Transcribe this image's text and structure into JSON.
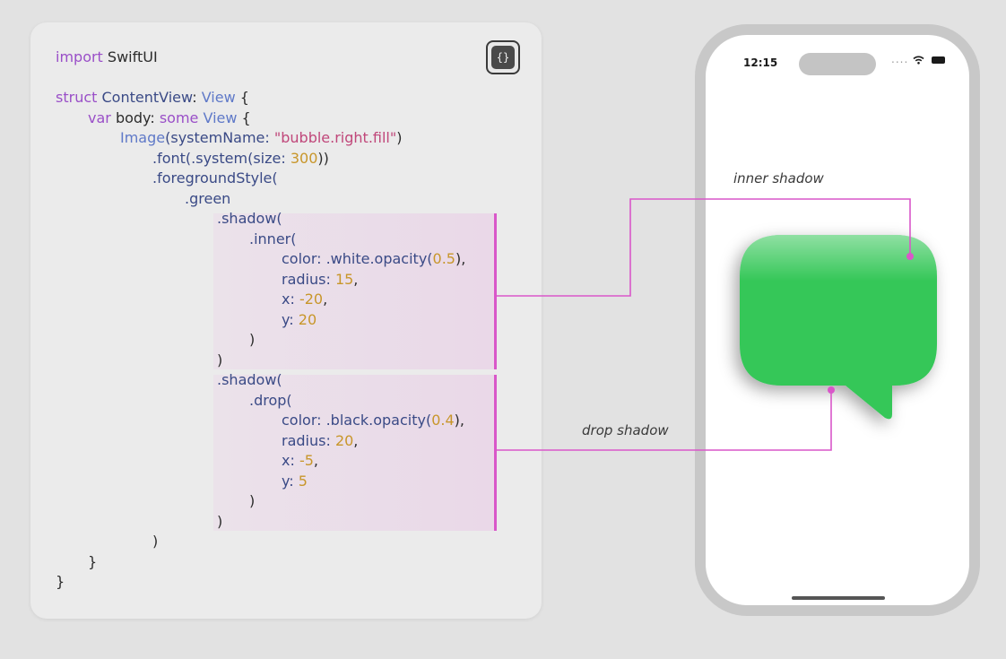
{
  "code_button": {
    "glyph": "{}"
  },
  "code_lines": [
    {
      "indent": 0,
      "tokens": [
        {
          "t": "import",
          "c": "kw"
        },
        {
          "t": " SwiftUI",
          "c": "plain"
        }
      ]
    },
    {
      "indent": 0,
      "tokens": []
    },
    {
      "indent": 0,
      "tokens": [
        {
          "t": "struct",
          "c": "kw"
        },
        {
          "t": " ContentView",
          "c": "id"
        },
        {
          "t": ": ",
          "c": "plain"
        },
        {
          "t": "View",
          "c": "type"
        },
        {
          "t": " {",
          "c": "plain"
        }
      ]
    },
    {
      "indent": 1,
      "tokens": [
        {
          "t": "var",
          "c": "kw"
        },
        {
          "t": " body: ",
          "c": "plain"
        },
        {
          "t": "some",
          "c": "kw"
        },
        {
          "t": " View",
          "c": "type"
        },
        {
          "t": " {",
          "c": "plain"
        }
      ]
    },
    {
      "indent": 2,
      "tokens": [
        {
          "t": "Image",
          "c": "type"
        },
        {
          "t": "(systemName: ",
          "c": "id"
        },
        {
          "t": "\"bubble.right.fill\"",
          "c": "str"
        },
        {
          "t": ")",
          "c": "plain"
        }
      ]
    },
    {
      "indent": 3,
      "tokens": [
        {
          "t": ".font(.system(size: ",
          "c": "id"
        },
        {
          "t": "300",
          "c": "num"
        },
        {
          "t": "))",
          "c": "plain"
        }
      ]
    },
    {
      "indent": 3,
      "tokens": [
        {
          "t": ".foregroundStyle(",
          "c": "id"
        }
      ]
    },
    {
      "indent": 4,
      "tokens": [
        {
          "t": ".green",
          "c": "id"
        }
      ]
    },
    {
      "indent": 5,
      "tokens": [
        {
          "t": ".shadow(",
          "c": "id"
        }
      ]
    },
    {
      "indent": 6,
      "tokens": [
        {
          "t": ".inner(",
          "c": "id"
        }
      ]
    },
    {
      "indent": 7,
      "tokens": [
        {
          "t": "color: .white.opacity(",
          "c": "id"
        },
        {
          "t": "0.5",
          "c": "num"
        },
        {
          "t": "),",
          "c": "plain"
        }
      ]
    },
    {
      "indent": 7,
      "tokens": [
        {
          "t": "radius: ",
          "c": "id"
        },
        {
          "t": "15",
          "c": "num"
        },
        {
          "t": ",",
          "c": "plain"
        }
      ]
    },
    {
      "indent": 7,
      "tokens": [
        {
          "t": "x: ",
          "c": "id"
        },
        {
          "t": "-20",
          "c": "num"
        },
        {
          "t": ",",
          "c": "plain"
        }
      ]
    },
    {
      "indent": 7,
      "tokens": [
        {
          "t": "y: ",
          "c": "id"
        },
        {
          "t": "20",
          "c": "num"
        }
      ]
    },
    {
      "indent": 6,
      "tokens": [
        {
          "t": ")",
          "c": "plain"
        }
      ]
    },
    {
      "indent": 5,
      "tokens": [
        {
          "t": ")",
          "c": "plain"
        }
      ]
    },
    {
      "indent": 5,
      "tokens": [
        {
          "t": ".shadow(",
          "c": "id"
        }
      ]
    },
    {
      "indent": 6,
      "tokens": [
        {
          "t": ".drop(",
          "c": "id"
        }
      ]
    },
    {
      "indent": 7,
      "tokens": [
        {
          "t": "color: .black.opacity(",
          "c": "id"
        },
        {
          "t": "0.4",
          "c": "num"
        },
        {
          "t": "),",
          "c": "plain"
        }
      ]
    },
    {
      "indent": 7,
      "tokens": [
        {
          "t": "radius: ",
          "c": "id"
        },
        {
          "t": "20",
          "c": "num"
        },
        {
          "t": ",",
          "c": "plain"
        }
      ]
    },
    {
      "indent": 7,
      "tokens": [
        {
          "t": "x: ",
          "c": "id"
        },
        {
          "t": "-5",
          "c": "num"
        },
        {
          "t": ",",
          "c": "plain"
        }
      ]
    },
    {
      "indent": 7,
      "tokens": [
        {
          "t": "y: ",
          "c": "id"
        },
        {
          "t": "5",
          "c": "num"
        }
      ]
    },
    {
      "indent": 6,
      "tokens": [
        {
          "t": ")",
          "c": "plain"
        }
      ]
    },
    {
      "indent": 5,
      "tokens": [
        {
          "t": ")",
          "c": "plain"
        }
      ]
    },
    {
      "indent": 3,
      "tokens": [
        {
          "t": ")",
          "c": "plain"
        }
      ]
    },
    {
      "indent": 1,
      "tokens": [
        {
          "t": "}",
          "c": "plain"
        }
      ]
    },
    {
      "indent": 0,
      "tokens": [
        {
          "t": "}",
          "c": "plain"
        }
      ]
    }
  ],
  "phone": {
    "time": "12:15",
    "status_icons": [
      "signal-dots-icon",
      "wifi-icon",
      "battery-icon"
    ],
    "status_glyphs": "....",
    "bubble_color": "#34c759"
  },
  "annotations": {
    "inner_shadow": "inner shadow",
    "drop_shadow": "drop shadow",
    "line_color": "#d957c9"
  }
}
